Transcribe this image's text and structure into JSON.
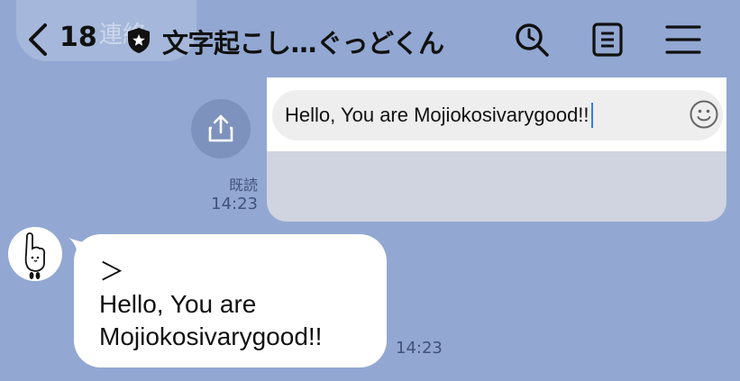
{
  "header": {
    "ghost_text": "連絡",
    "back_count": "18",
    "title": "文字起こし…ぐっどくん"
  },
  "composer": {
    "input_value": "Hello, You are Mojiokosivarygood!!"
  },
  "messages": [
    {
      "side": "right",
      "read_label": "既読",
      "time": "14:23"
    },
    {
      "side": "left",
      "lines": [
        "＞",
        "Hello, You are",
        "Mojiokosivarygood!!"
      ],
      "time": "14:23"
    }
  ],
  "colors": {
    "background": "#92a8d2",
    "bubble": "#ffffff",
    "caret": "#3a78f2"
  }
}
